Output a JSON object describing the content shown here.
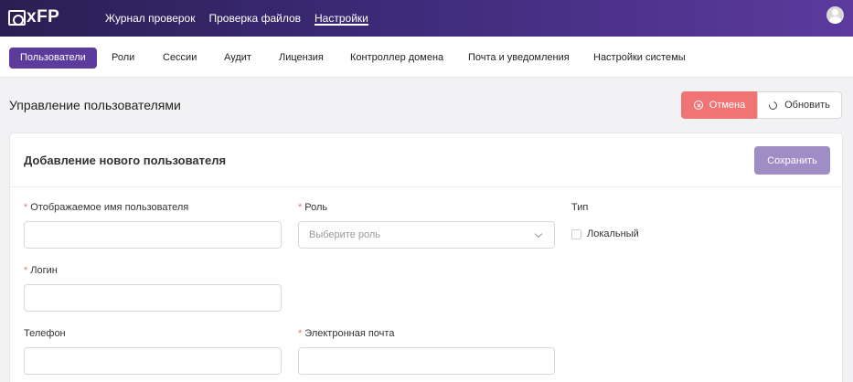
{
  "app": {
    "logo_text": "xFP"
  },
  "topnav": {
    "items": [
      {
        "label": "Журнал проверок",
        "active": false
      },
      {
        "label": "Проверка файлов",
        "active": false
      },
      {
        "label": "Настройки",
        "active": true
      }
    ]
  },
  "tabs": [
    {
      "label": "Пользователи",
      "active": true
    },
    {
      "label": "Роли",
      "active": false
    },
    {
      "label": "Сессии",
      "active": false
    },
    {
      "label": "Аудит",
      "active": false
    },
    {
      "label": "Лицензия",
      "active": false
    },
    {
      "label": "Контроллер домена",
      "active": false
    },
    {
      "label": "Почта и уведомления",
      "active": false
    },
    {
      "label": "Настройки системы",
      "active": false
    }
  ],
  "page": {
    "title": "Управление пользователями",
    "cancel_label": "Отмена",
    "refresh_label": "Обновить"
  },
  "form": {
    "title": "Добавление нового пользователя",
    "save_label": "Сохранить",
    "required_mark": "*",
    "display_name": {
      "label": "Отображаемое имя пользователя",
      "value": ""
    },
    "role": {
      "label": "Роль",
      "placeholder": "Выберите роль"
    },
    "type": {
      "label": "Тип",
      "option_label": "Локальный",
      "checked": false
    },
    "login": {
      "label": "Логин",
      "value": ""
    },
    "phone": {
      "label": "Телефон",
      "value": ""
    },
    "email": {
      "label": "Электронная почта",
      "value": ""
    }
  },
  "colors": {
    "header_gradient_start": "#2a1e52",
    "header_gradient_end": "#5c3a9e",
    "accent": "#5b3b9c",
    "cancel": "#f07474",
    "save": "#a08dc6",
    "required": "#f07474"
  },
  "icons": {
    "logo": "shield-logo-icon",
    "avatar": "user-avatar-icon",
    "cancel": "x-circle-icon",
    "refresh": "refresh-icon",
    "select": "chevron-down-icon"
  }
}
